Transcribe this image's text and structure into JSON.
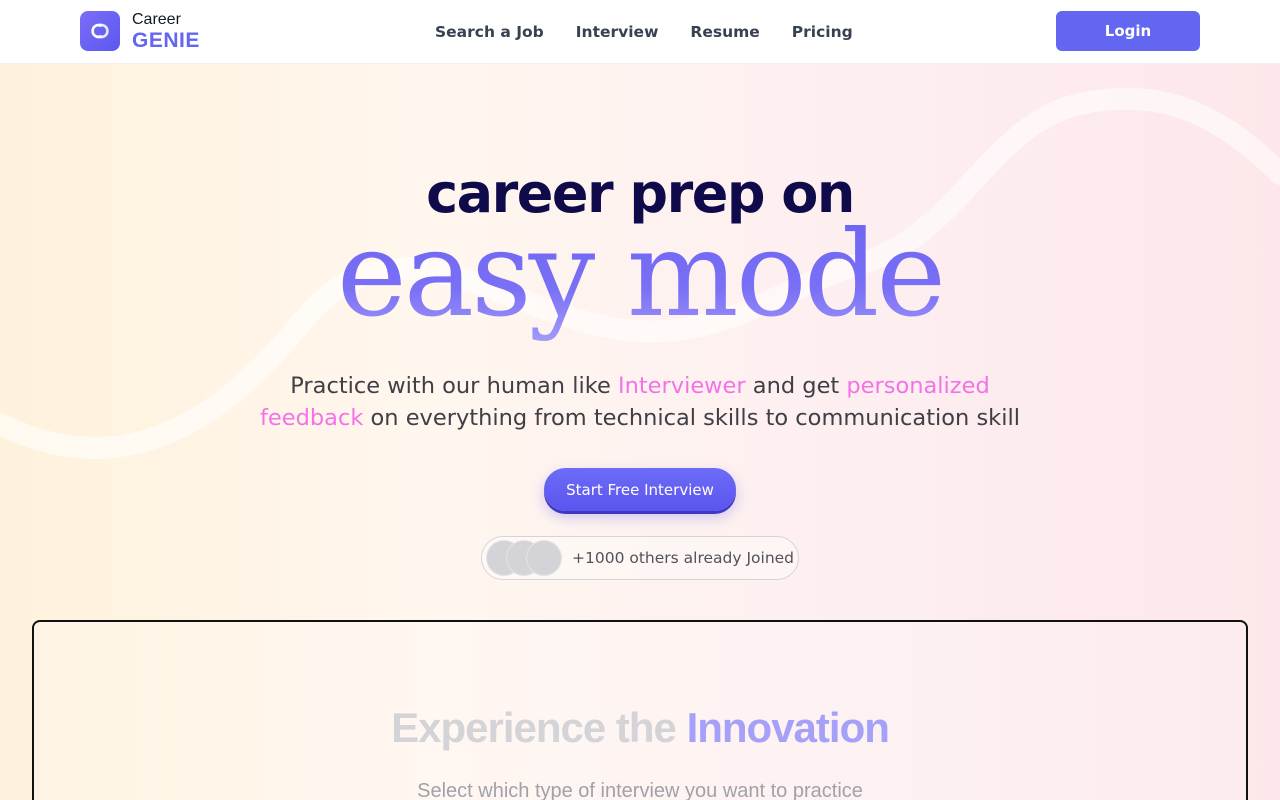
{
  "brand": {
    "name_top": "Career",
    "name_bottom": "GENIE",
    "logo_icon": "link-loop-icon",
    "accent_color": "#6366f1"
  },
  "nav": {
    "items": [
      {
        "label": "Search a Job"
      },
      {
        "label": "Interview"
      },
      {
        "label": "Resume"
      },
      {
        "label": "Pricing"
      }
    ],
    "login_label": "Login"
  },
  "hero": {
    "title_line1": "career prep on",
    "title_line2": "easy mode",
    "subtitle_part1": "Practice with our human like ",
    "subtitle_highlight1": "Interviewer",
    "subtitle_part2": " and get ",
    "subtitle_highlight2": "personalized feedback",
    "subtitle_part3": " on everything from technical skills to communication skill",
    "cta_label": "Start Free Interview",
    "joined_text": "+1000 others already Joined",
    "highlight_color": "#f472e8"
  },
  "innovation": {
    "title_part1": "Experience the ",
    "title_part2": "Innovation",
    "subtitle": "Select which type of interview you want to practice"
  }
}
